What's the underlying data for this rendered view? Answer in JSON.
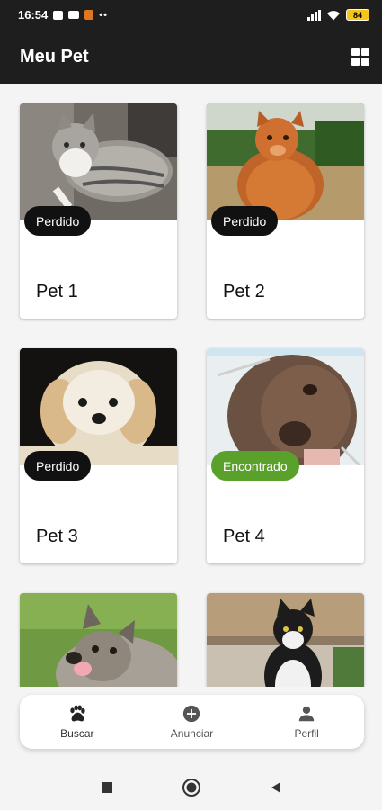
{
  "status_bar": {
    "time": "16:54",
    "battery": "84"
  },
  "app_bar": {
    "title": "Meu Pet"
  },
  "pets": [
    {
      "name": "Pet 1",
      "status": "Perdido"
    },
    {
      "name": "Pet 2",
      "status": "Perdido"
    },
    {
      "name": "Pet 3",
      "status": "Perdido"
    },
    {
      "name": "Pet 4",
      "status": "Encontrado"
    },
    {
      "name": ""
    },
    {
      "name": ""
    }
  ],
  "bottom_nav": {
    "items": [
      {
        "label": "Buscar",
        "icon": "paw-icon"
      },
      {
        "label": "Anunciar",
        "icon": "add-circle-icon"
      },
      {
        "label": "Perfil",
        "icon": "person-icon"
      }
    ]
  },
  "colors": {
    "app_bar": "#1e1e1e",
    "lost_badge": "#111111",
    "found_badge": "#5aa12b",
    "background": "#f4f4f4"
  }
}
